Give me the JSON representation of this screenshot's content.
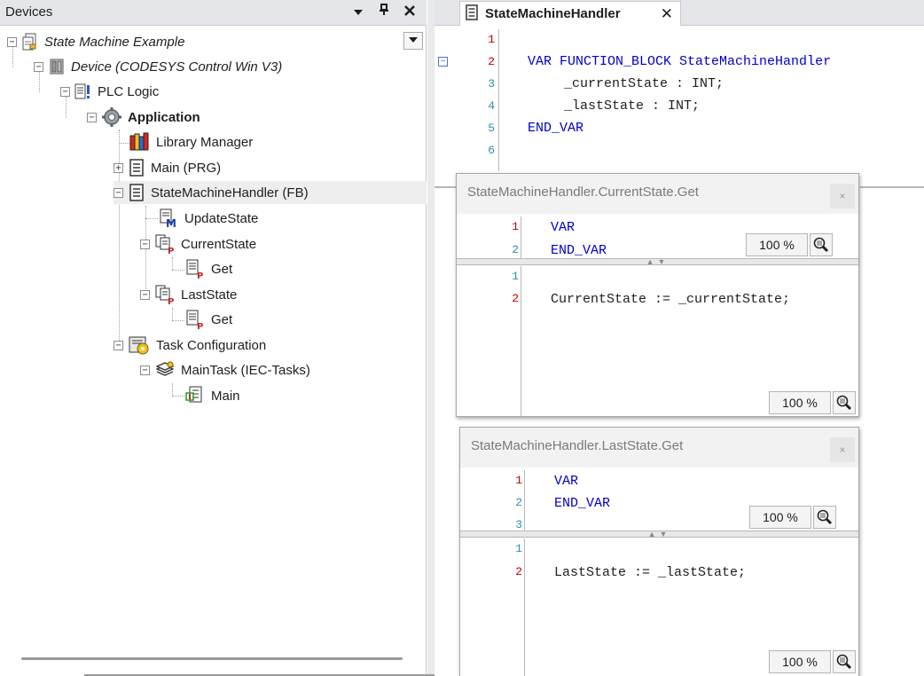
{
  "devices_panel": {
    "title": "Devices",
    "header_icons": [
      "dropdown-arrow-icon",
      "pin-icon",
      "close-icon"
    ],
    "tree": [
      {
        "label": "State Machine Example",
        "icon": "project-icon",
        "style": "italic",
        "expander": "−"
      },
      {
        "label": "Device (CODESYS Control Win V3)",
        "icon": "device-icon",
        "style": "italic",
        "expander": "−"
      },
      {
        "label": "PLC Logic",
        "icon": "plc-logic-icon",
        "style": "normal",
        "expander": "−"
      },
      {
        "label": "Application",
        "icon": "application-gear-icon",
        "style": "bold",
        "expander": "−"
      },
      {
        "label": "Library Manager",
        "icon": "library-books-icon",
        "style": "normal",
        "expander": ""
      },
      {
        "label": "Main (PRG)",
        "icon": "program-doc-icon",
        "style": "normal",
        "expander": "+"
      },
      {
        "label": "StateMachineHandler (FB)",
        "icon": "function-block-doc-icon",
        "style": "normal",
        "expander": "−"
      },
      {
        "label": "UpdateState",
        "icon": "method-icon",
        "style": "normal",
        "expander": ""
      },
      {
        "label": "CurrentState",
        "icon": "property-icon",
        "style": "normal",
        "expander": "−"
      },
      {
        "label": "Get",
        "icon": "property-get-icon",
        "style": "normal",
        "expander": ""
      },
      {
        "label": "LastState",
        "icon": "property-icon",
        "style": "normal",
        "expander": "−"
      },
      {
        "label": "Get",
        "icon": "property-get-icon",
        "style": "normal",
        "expander": ""
      },
      {
        "label": "Task Configuration",
        "icon": "task-configuration-icon",
        "style": "normal",
        "expander": "−"
      },
      {
        "label": "MainTask (IEC-Tasks)",
        "icon": "task-icon",
        "style": "normal",
        "expander": "−"
      },
      {
        "label": "Main",
        "icon": "program-call-icon",
        "style": "normal",
        "expander": ""
      }
    ]
  },
  "editor": {
    "tab": {
      "label": "StateMachineHandler",
      "close": "✕"
    },
    "lines": [
      {
        "n": "1",
        "code": "FUNCTION_BLOCK StateMachineHandler"
      },
      {
        "n": "2",
        "code": "VAR"
      },
      {
        "n": "3",
        "code": "_currentState : INT;"
      },
      {
        "n": "4",
        "code": "_lastState : INT;"
      },
      {
        "n": "5",
        "code": "END_VAR"
      },
      {
        "n": "6",
        "code": ""
      }
    ],
    "collapse_glyph": "⊟"
  },
  "popup_current": {
    "title": "StateMachineHandler.CurrentState.Get",
    "close": "×",
    "decl_lines": [
      {
        "n": "1",
        "code": "VAR"
      },
      {
        "n": "2",
        "code": "END_VAR"
      }
    ],
    "impl_lines": [
      {
        "n": "1",
        "code": ""
      },
      {
        "n": "2",
        "code": "CurrentState := _currentState;"
      }
    ],
    "zoom_top": "100 %",
    "zoom_bottom": "100 %"
  },
  "popup_last": {
    "title": "StateMachineHandler.LastState.Get",
    "close": "×",
    "decl_lines": [
      {
        "n": "1",
        "code": "VAR"
      },
      {
        "n": "2",
        "code": "END_VAR"
      },
      {
        "n": "3",
        "code": ""
      }
    ],
    "impl_lines": [
      {
        "n": "1",
        "code": ""
      },
      {
        "n": "2",
        "code": "LastState := _lastState;"
      }
    ],
    "zoom_top": "100 %",
    "zoom_bottom": "100 %"
  },
  "colors": {
    "keyword": "#0000cd",
    "line_number": "#2b91af",
    "modified_line_number": "#c00000",
    "panel_header": "#e4e6ea"
  }
}
